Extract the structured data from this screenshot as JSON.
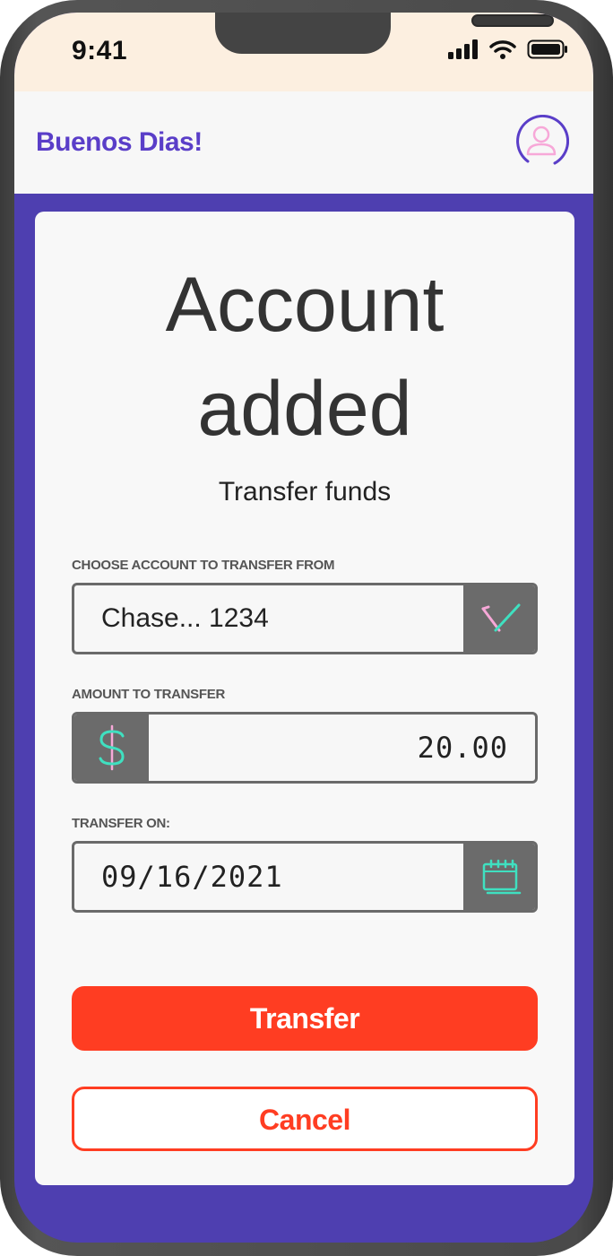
{
  "status_bar": {
    "time": "9:41"
  },
  "header": {
    "greeting": "Buenos Dias!"
  },
  "card": {
    "title": "Account added",
    "subtitle": "Transfer funds",
    "from_account": {
      "label": "CHOOSE ACCOUNT TO TRANSFER FROM",
      "value": "Chase... 1234"
    },
    "amount": {
      "label": "AMOUNT TO TRANSFER",
      "currency_symbol": "$",
      "value": "20.00"
    },
    "transfer_on": {
      "label": "TRANSFER ON:",
      "value": "09/16/2021"
    },
    "transfer_button": "Transfer",
    "cancel_button": "Cancel"
  },
  "colors": {
    "brand_purple": "#5a3ec8",
    "background_purple": "#4e3fb0",
    "accent_red": "#ff3d22",
    "accent_teal": "#3fe0c0",
    "accent_pink": "#f7a8d8"
  },
  "icons": [
    "signal-icon",
    "wifi-icon",
    "battery-icon",
    "user-avatar-icon",
    "checkmark-dropdown-icon",
    "dollar-icon",
    "calendar-icon"
  ]
}
